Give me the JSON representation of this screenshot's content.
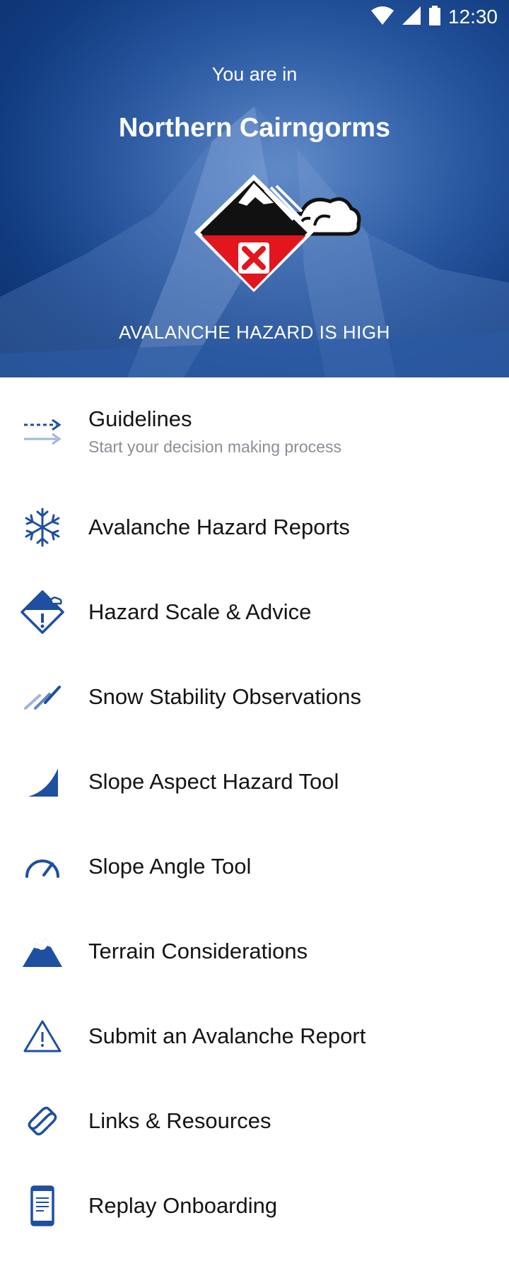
{
  "status_bar": {
    "time": "12:30",
    "icons": [
      "wifi-icon",
      "signal-icon",
      "battery-icon"
    ]
  },
  "hero": {
    "subtitle": "You are in",
    "region": "Northern Cairngorms",
    "hazard_icon": "avalanche-hazard-high-icon",
    "hazard_text": "AVALANCHE HAZARD IS HIGH",
    "colors": {
      "background": "#1a4a94",
      "hazard_red": "#e3151d"
    }
  },
  "menu": {
    "items": [
      {
        "label": "Guidelines",
        "subtitle": "Start your decision making process",
        "icon": "guidelines-arrows-icon"
      },
      {
        "label": "Avalanche Hazard Reports",
        "icon": "snowflake-icon"
      },
      {
        "label": "Hazard Scale & Advice",
        "icon": "hazard-scale-icon"
      },
      {
        "label": "Snow Stability Observations",
        "icon": "snow-stability-icon"
      },
      {
        "label": "Slope Aspect Hazard Tool",
        "icon": "slope-aspect-icon"
      },
      {
        "label": "Slope Angle Tool",
        "icon": "slope-angle-gauge-icon"
      },
      {
        "label": "Terrain Considerations",
        "icon": "mountain-icon"
      },
      {
        "label": "Submit an Avalanche Report",
        "icon": "warning-triangle-icon"
      },
      {
        "label": "Links & Resources",
        "icon": "link-icon"
      },
      {
        "label": "Replay Onboarding",
        "icon": "phone-document-icon"
      }
    ],
    "icon_color": "#1e4fa0"
  }
}
